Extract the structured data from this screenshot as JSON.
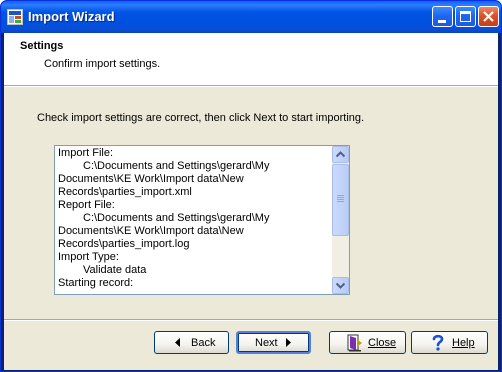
{
  "window": {
    "title": "Import Wizard"
  },
  "header": {
    "title": "Settings",
    "subtitle": "Confirm import settings."
  },
  "instruction": "Check import settings are correct, then click Next to start importing.",
  "settings_list": {
    "lines": [
      {
        "text": "Import File:",
        "indent": false
      },
      {
        "text": "C:\\Documents and Settings\\gerard\\My",
        "indent": true
      },
      {
        "text": "Documents\\KE Work\\Import data\\New",
        "indent": false
      },
      {
        "text": "Records\\parties_import.xml",
        "indent": false
      },
      {
        "text": "Report File:",
        "indent": false
      },
      {
        "text": "C:\\Documents and Settings\\gerard\\My",
        "indent": true
      },
      {
        "text": "Documents\\KE Work\\Import data\\New",
        "indent": false
      },
      {
        "text": "Records\\parties_import.log",
        "indent": false
      },
      {
        "text": "Import Type:",
        "indent": false
      },
      {
        "text": "Validate data",
        "indent": true
      },
      {
        "text": "Starting record:",
        "indent": false
      }
    ]
  },
  "buttons": {
    "back": "Back",
    "next": "Next",
    "close": "Close",
    "help": "Help"
  },
  "colors": {
    "title_bar": "#0054e3",
    "window_bg": "#ece9d8",
    "close_button": "#d9532a",
    "help_icon": "#1c4fd8",
    "close_icon": "#7a2fb0"
  },
  "icons": [
    "app-icon",
    "minimize-icon",
    "maximize-icon",
    "close-icon",
    "arrow-left-icon",
    "arrow-right-icon",
    "door-exit-icon",
    "question-mark-icon",
    "scroll-up-icon",
    "scroll-down-icon"
  ]
}
